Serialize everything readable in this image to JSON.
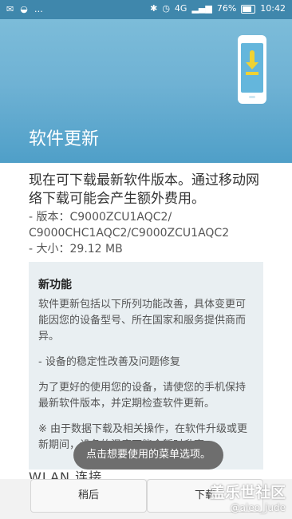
{
  "status_bar": {
    "left_icons": [
      "message-icon",
      "qq-icon",
      "more-dots-icon"
    ],
    "right_icons": [
      "bluetooth-icon",
      "alarm-icon",
      "network-4g-icon",
      "signal-icon",
      "battery-icon"
    ],
    "battery": "76%",
    "time": "10:42"
  },
  "header": {
    "title": "软件更新",
    "icon": "phone-download-icon"
  },
  "intro": "现在可下载最新软件版本。通过移动网络下载可能会产生额外费用。",
  "meta": {
    "version_line1": "- 版本：C9000ZCU1AQC2/",
    "version_line2": "C9000CHC1AQC2/C9000ZCU1AQC2",
    "size": "- 大小：29.12 MB"
  },
  "notice": {
    "title": "新功能",
    "body1": "软件更新包括以下所列功能改善，具体变更可能因您的设备型号、所在国家和服务提供商而异。",
    "body2": "- 设备的稳定性改善及问题修复",
    "body3": "为了更好的使用您的设备，请使您的手机保持最新软件版本，并定期检查软件更新。",
    "body4": "※ 由于数据下载及相关操作，在软件升级或更新期间，设备的温度可能会暂时升高。"
  },
  "wlan_partial": "WLAN 连接",
  "toast": "点击想要使用的菜单选项。",
  "buttons": {
    "later": "稍后",
    "download": "下载"
  },
  "watermark": {
    "line1": "盖乐世社区",
    "line2": "@aleo_jude"
  }
}
